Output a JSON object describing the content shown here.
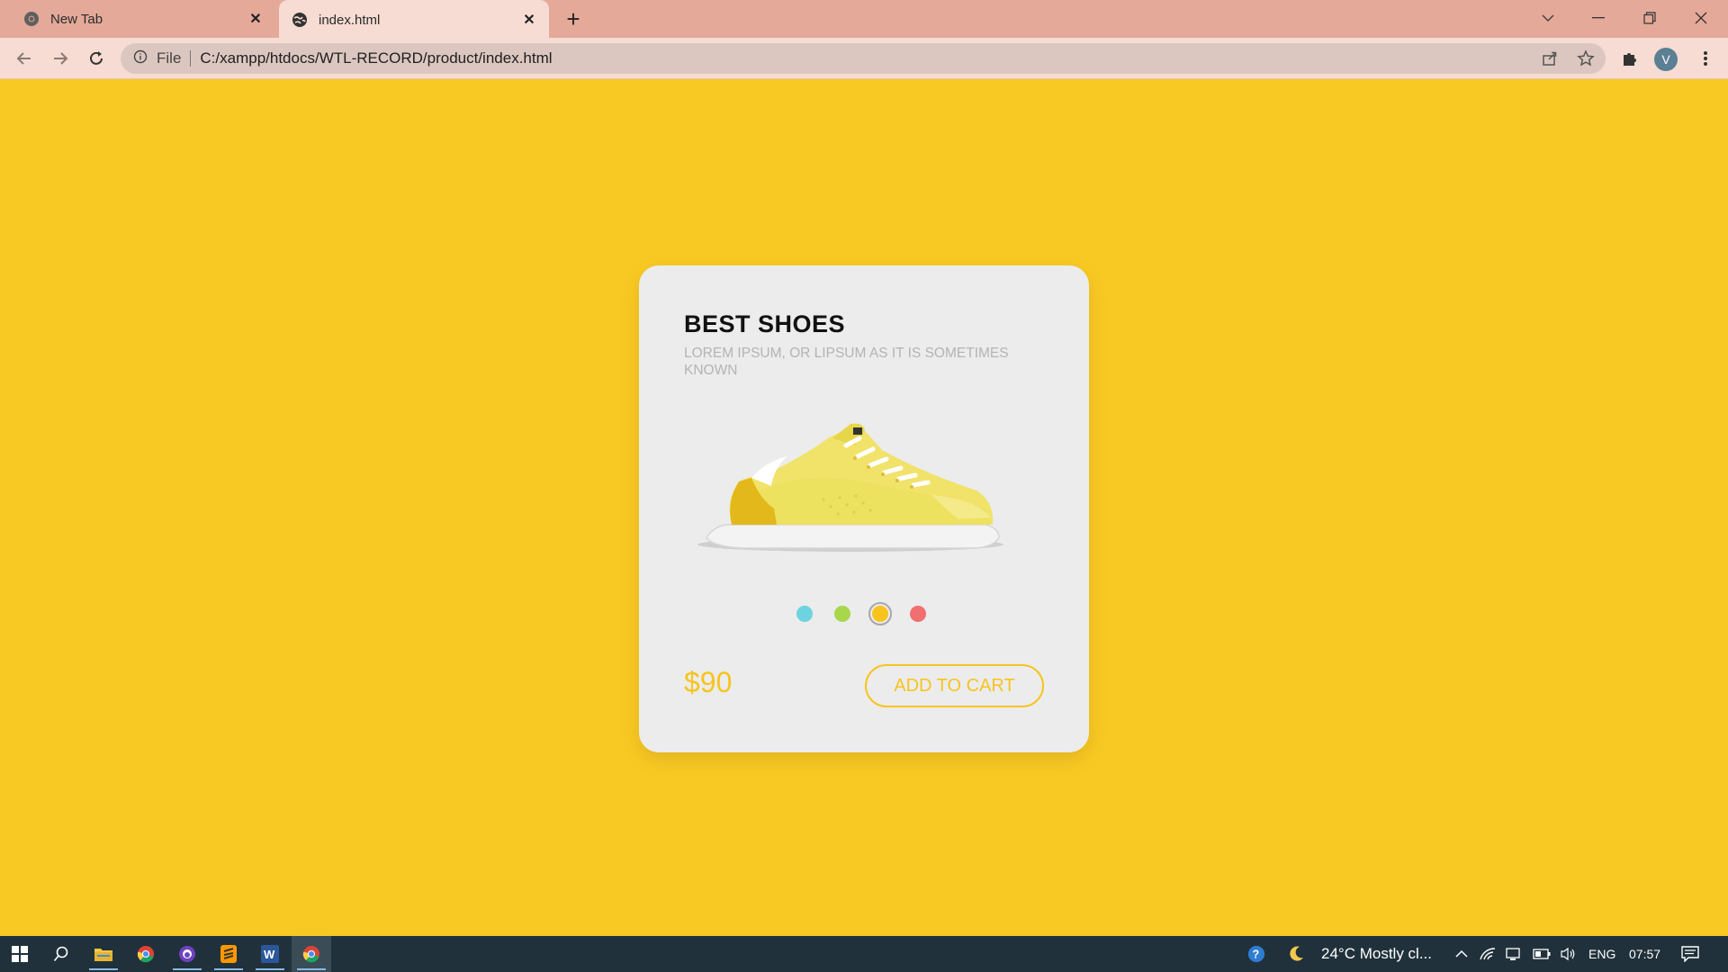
{
  "browser": {
    "tabs": [
      {
        "title": "New Tab",
        "favicon": "chrome-icon",
        "active": false
      },
      {
        "title": "index.html",
        "favicon": "globe-icon",
        "active": true
      }
    ],
    "address_scheme_label": "File",
    "address_url": "C:/xampp/htdocs/WTL-RECORD/product/index.html",
    "profile_initial": "V"
  },
  "card": {
    "title": "BEST SHOES",
    "subtitle": "LOREM IPSUM, OR LIPSUM AS IT IS SOMETIMES KNOWN",
    "image": "yellow-sneaker",
    "color_options": [
      {
        "color": "#6dd3df",
        "selected": false
      },
      {
        "color": "#a9d74c",
        "selected": false
      },
      {
        "color": "#f7c41d",
        "selected": true
      },
      {
        "color": "#f16f70",
        "selected": false
      }
    ],
    "price": "$90",
    "button_label": "ADD TO CART"
  },
  "taskbar": {
    "apps": [
      "windows-start",
      "search",
      "file-explorer",
      "chrome",
      "github-desktop",
      "sublime-text",
      "word",
      "chrome-active"
    ],
    "weather": "24°C  Mostly cl...",
    "language": "ENG",
    "time": "07:57"
  },
  "colors": {
    "page_background": "#f9c923",
    "card_background": "#ececed",
    "accent": "#f7c41d"
  }
}
